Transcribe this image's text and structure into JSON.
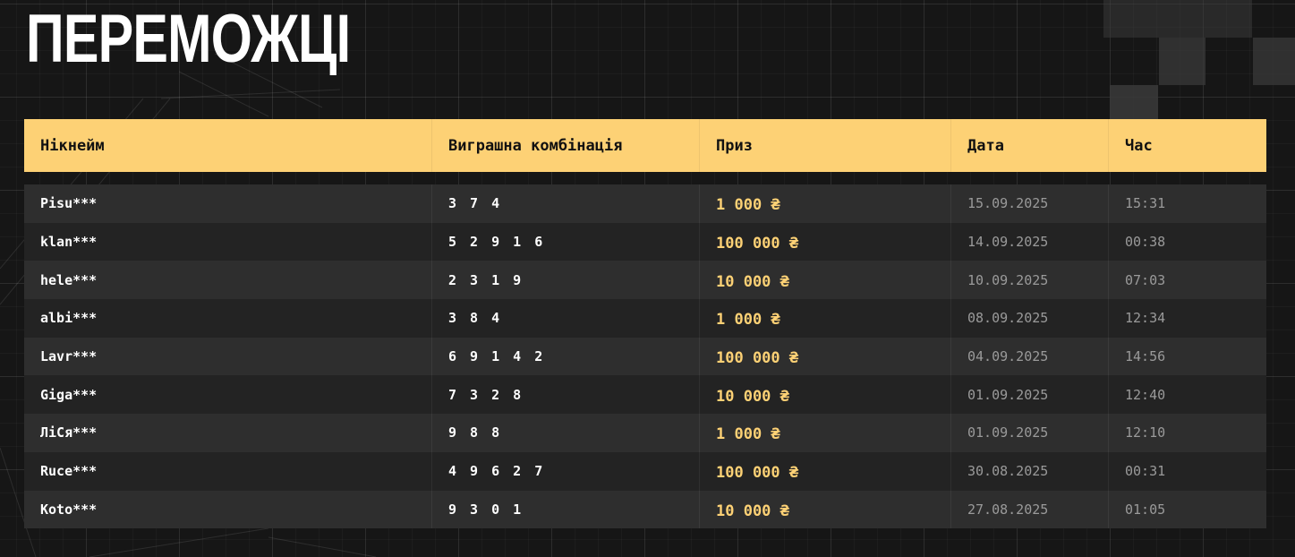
{
  "title": "ПЕРЕМОЖЦІ",
  "table": {
    "headers": {
      "nickname": "Нікнейм",
      "combination": "Виграшна комбінація",
      "prize": "Приз",
      "date": "Дата",
      "time": "Час"
    },
    "rows": [
      {
        "nickname": "Pisu***",
        "combination": "3 7 4",
        "prize": "1 000 ₴",
        "date": "15.09.2025",
        "time": "15:31"
      },
      {
        "nickname": "klan***",
        "combination": "5 2 9 1 6",
        "prize": "100 000 ₴",
        "date": "14.09.2025",
        "time": "00:38"
      },
      {
        "nickname": "hele***",
        "combination": "2 3 1 9",
        "prize": "10 000 ₴",
        "date": "10.09.2025",
        "time": "07:03"
      },
      {
        "nickname": "albi***",
        "combination": "3 8 4",
        "prize": "1 000 ₴",
        "date": "08.09.2025",
        "time": "12:34"
      },
      {
        "nickname": "Lavr***",
        "combination": "6 9 1 4 2",
        "prize": "100 000 ₴",
        "date": "04.09.2025",
        "time": "14:56"
      },
      {
        "nickname": "Giga***",
        "combination": "7 3 2 8",
        "prize": "10 000 ₴",
        "date": "01.09.2025",
        "time": "12:40"
      },
      {
        "nickname": "ЛіСя***",
        "combination": "9 8 8",
        "prize": "1 000 ₴",
        "date": "01.09.2025",
        "time": "12:10"
      },
      {
        "nickname": "Ruce***",
        "combination": "4 9 6 2 7",
        "prize": "100 000 ₴",
        "date": "30.08.2025",
        "time": "00:31"
      },
      {
        "nickname": "Koto***",
        "combination": "9 3 0 1",
        "prize": "10 000 ₴",
        "date": "27.08.2025",
        "time": "01:05"
      }
    ]
  },
  "colors": {
    "accent": "#fdd175",
    "background": "#161616",
    "row_dark": "#232323",
    "row_light": "#2e2e2e"
  }
}
